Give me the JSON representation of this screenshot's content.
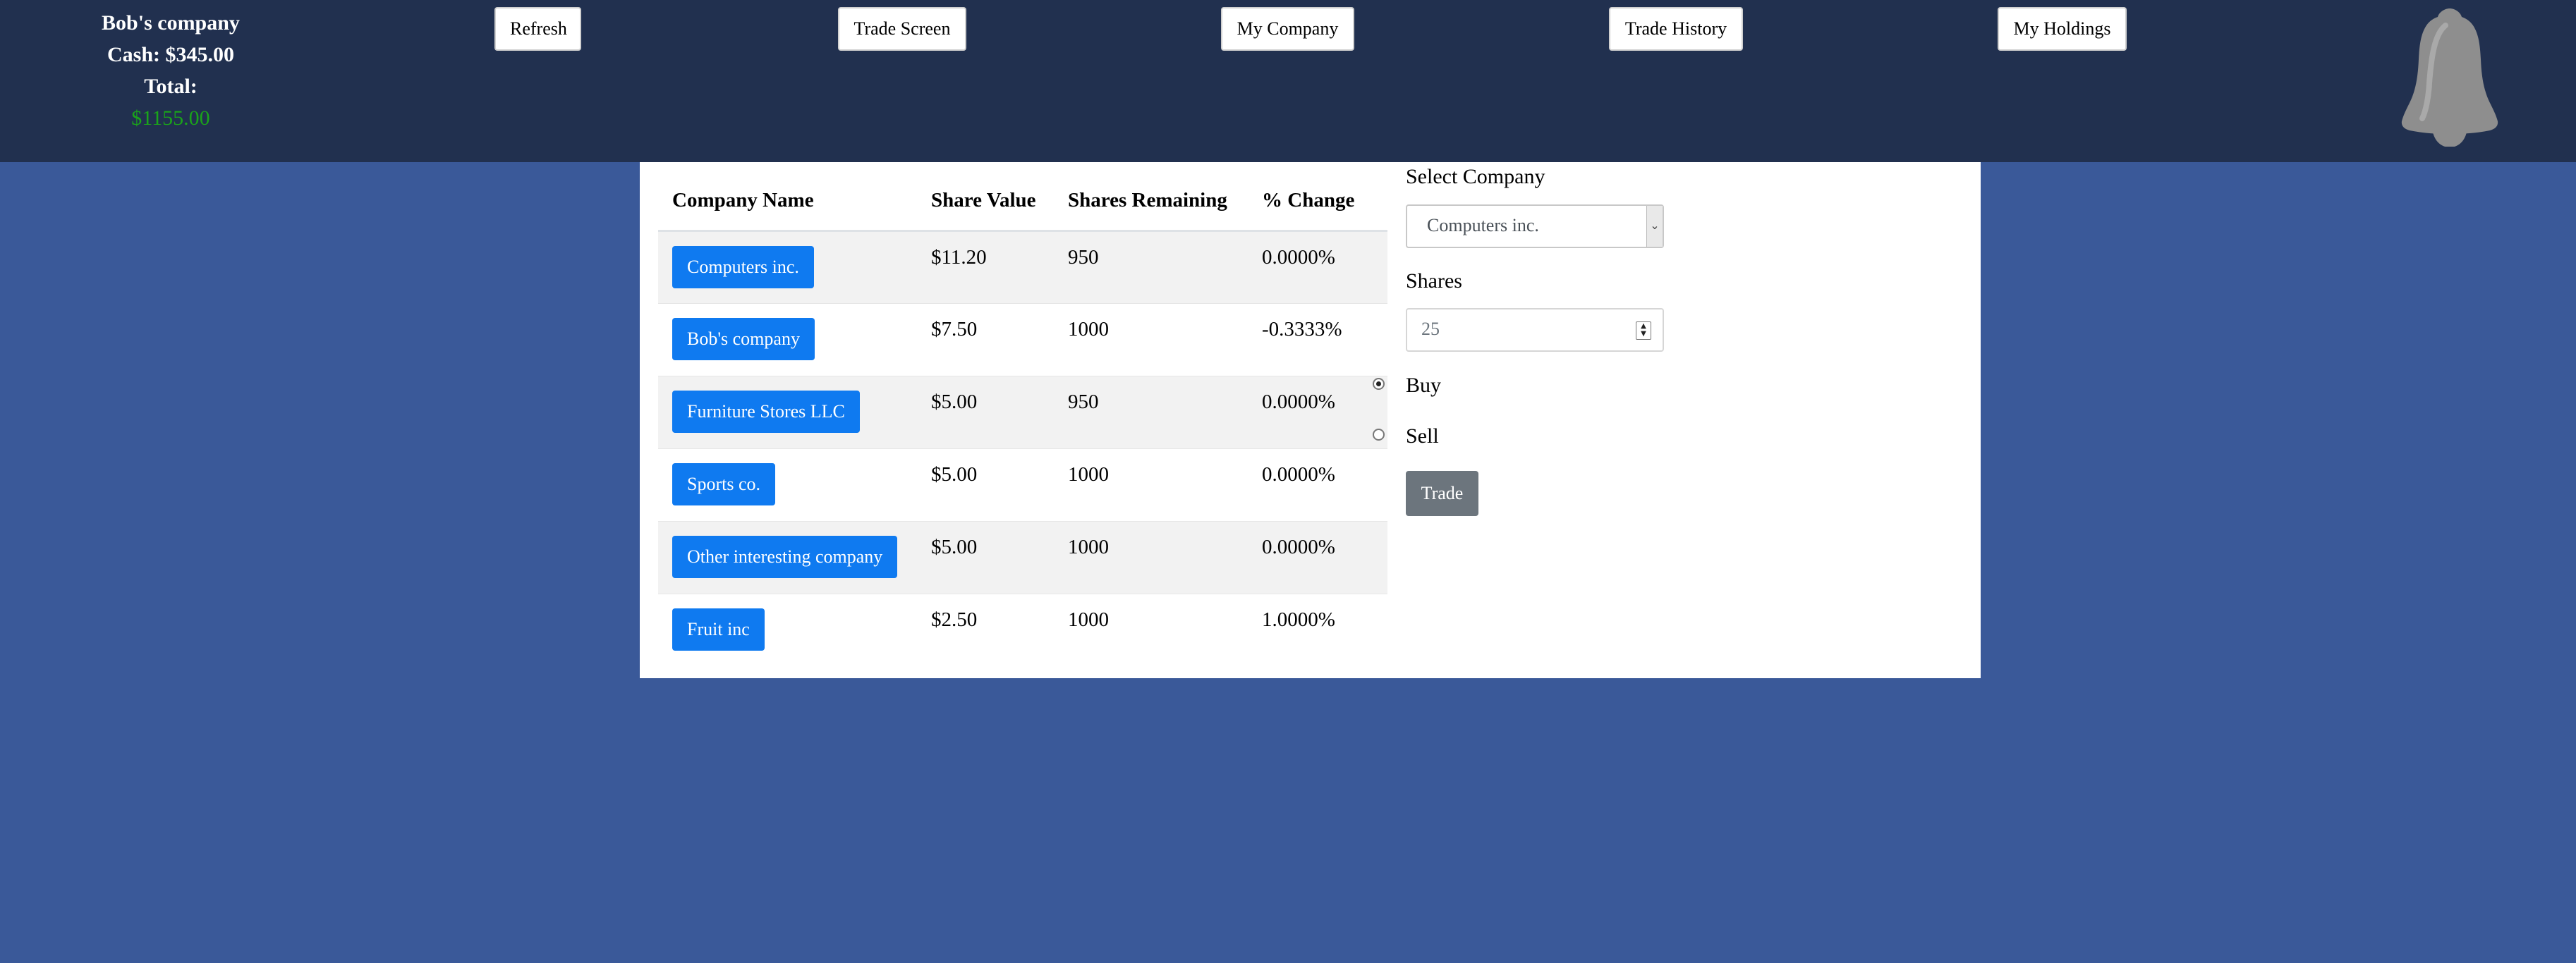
{
  "header": {
    "company_name": "Bob's company",
    "cash_line": "Cash: $345.00",
    "total_label": "Total:",
    "total_value": "$1155.00",
    "total_color": "#1aa31a"
  },
  "nav": {
    "refresh": "Refresh",
    "trade_screen": "Trade Screen",
    "my_company": "My Company",
    "trade_history": "Trade History",
    "my_holdings": "My Holdings"
  },
  "notifications_icon": "bell-icon",
  "table": {
    "headers": [
      "Company Name",
      "Share Value",
      "Shares Remaining",
      "% Change"
    ],
    "rows": [
      {
        "name": "Computers inc.",
        "value": "$11.20",
        "remaining": "950",
        "change": "0.0000%"
      },
      {
        "name": "Bob's company",
        "value": "$7.50",
        "remaining": "1000",
        "change": "-0.3333%"
      },
      {
        "name": "Furniture Stores LLC",
        "value": "$5.00",
        "remaining": "950",
        "change": "0.0000%"
      },
      {
        "name": "Sports co.",
        "value": "$5.00",
        "remaining": "1000",
        "change": "0.0000%"
      },
      {
        "name": "Other interesting company",
        "value": "$5.00",
        "remaining": "1000",
        "change": "0.0000%"
      },
      {
        "name": "Fruit inc",
        "value": "$2.50",
        "remaining": "1000",
        "change": "1.0000%"
      }
    ]
  },
  "trade_form": {
    "select_label": "Select Company",
    "selected_company": "Computers inc.",
    "shares_label": "Shares",
    "shares_value": "25",
    "buy_label": "Buy",
    "sell_label": "Sell",
    "selected_action": "Buy",
    "trade_button": "Trade"
  },
  "colors": {
    "page_background": "#3a5999",
    "header_background": "#21304f",
    "company_button": "#0f7af0",
    "trade_button": "#6c757d"
  }
}
